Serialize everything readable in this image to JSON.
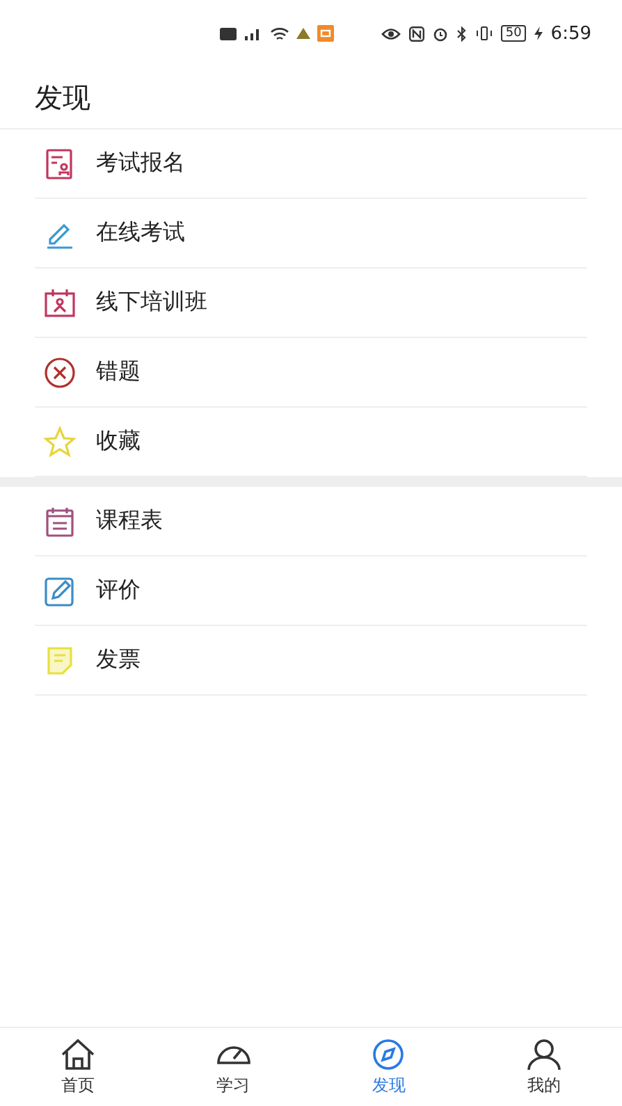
{
  "status_bar": {
    "battery": "50",
    "time": "6:59"
  },
  "header": {
    "title": "发现"
  },
  "sections": [
    {
      "items": [
        {
          "label": "考试报名",
          "kind": "form",
          "color": "#c0375e"
        },
        {
          "label": "在线考试",
          "kind": "pen",
          "color": "#3a9ad0"
        },
        {
          "label": "线下培训班",
          "kind": "class",
          "color": "#c0375e"
        },
        {
          "label": "错题",
          "kind": "cross",
          "color": "#b0302a"
        },
        {
          "label": "收藏",
          "kind": "star",
          "color": "#e8d43a"
        }
      ]
    },
    {
      "items": [
        {
          "label": "课程表",
          "kind": "schedule",
          "color": "#a0507e"
        },
        {
          "label": "评价",
          "kind": "edit",
          "color": "#3a8cc8"
        },
        {
          "label": "发票",
          "kind": "invoice",
          "color": "#e8e040"
        }
      ]
    }
  ],
  "tabs": [
    {
      "label": "首页",
      "kind": "home",
      "selected": false
    },
    {
      "label": "学习",
      "kind": "gauge",
      "selected": false
    },
    {
      "label": "发现",
      "kind": "discover",
      "selected": true
    },
    {
      "label": "我的",
      "kind": "person",
      "selected": false
    }
  ]
}
